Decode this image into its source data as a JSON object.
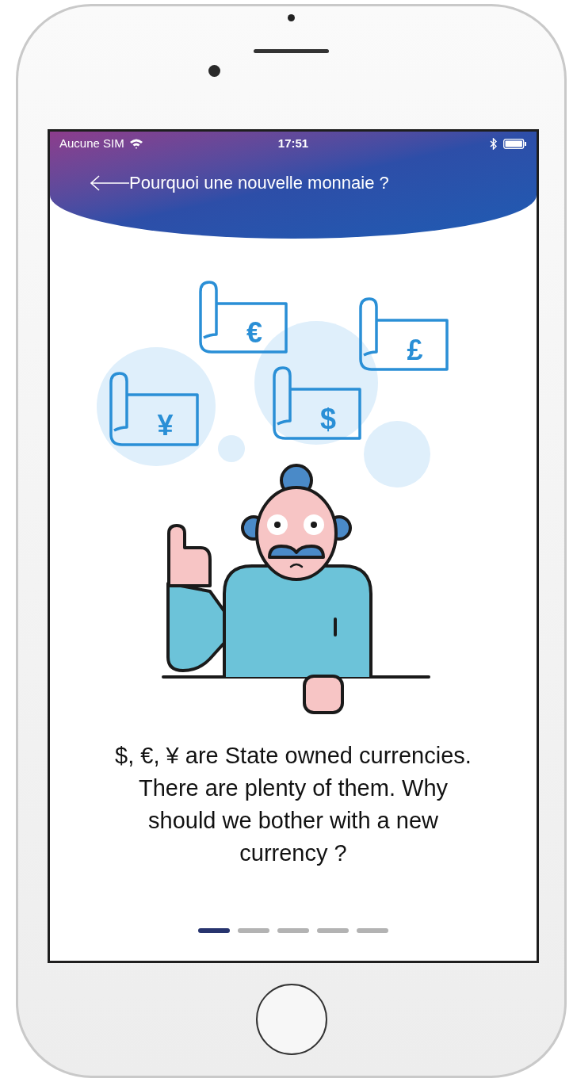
{
  "status_bar": {
    "carrier": "Aucune SIM",
    "time": "17:51"
  },
  "header": {
    "title": "Pourquoi une nouvelle monnaie ?"
  },
  "illustration": {
    "banknotes": [
      {
        "symbol": "€"
      },
      {
        "symbol": "£"
      },
      {
        "symbol": "$"
      },
      {
        "symbol": "¥"
      }
    ]
  },
  "description": "$, €, ¥ are State owned currencies. There are plenty of them. Why should we bother with a new currency ?",
  "pages": [
    {
      "selected": true
    },
    {
      "selected": false
    },
    {
      "selected": false
    },
    {
      "selected": false
    },
    {
      "selected": false
    }
  ]
}
